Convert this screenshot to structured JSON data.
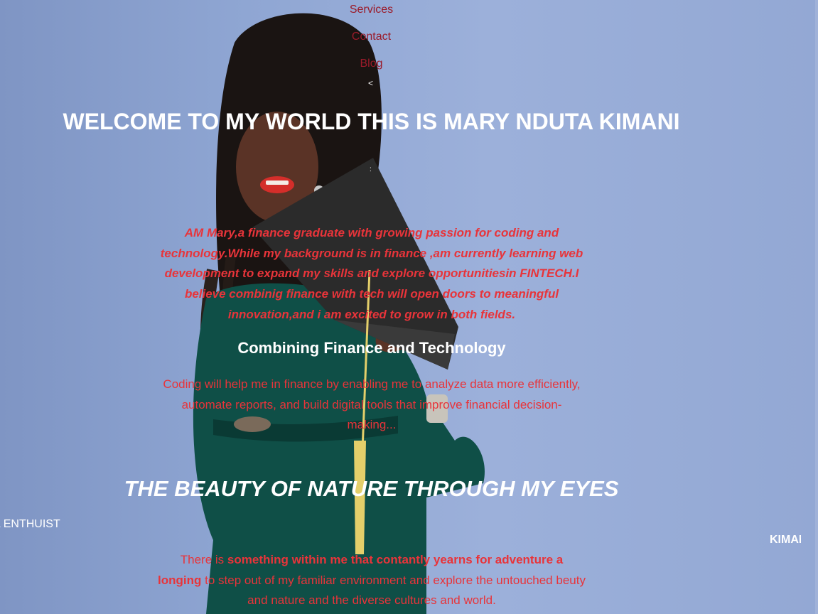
{
  "nav": {
    "items": [
      "Services",
      "Contact",
      "Blog"
    ],
    "arrow": "<"
  },
  "hero": {
    "title": "WELCOME TO MY WORLD THIS IS MARY NDUTA KIMANI",
    "colon": ":"
  },
  "intro": {
    "text": "AM Mary,a finance graduate with growing passion for coding and technology.While my background is in finance ,am currently learning web development to expand my skills and explore opportunitiesin FINTECH.I believe combinig finance with tech will open doors to meaningful innovation,and i am excited to grow in both fields."
  },
  "combining": {
    "title": "Combining Finance and Technology",
    "text": "Coding will help me in finance by enabling me to analyze data more efficiently, automate reports, and build digital tools that improve financial decision-making..."
  },
  "nature": {
    "title": "THE BEAUTY OF NATURE THROUGH MY EYES",
    "marquee_left": "L ENTHUIST",
    "marquee_right": "KIMANI",
    "text_before": "There is ",
    "text_bold": "something within me that contantly yearns for adventure a longing",
    "text_after": " to step out of my familiar environment and explore the untouched beuty and nature and the diverse cultures and world."
  },
  "colors": {
    "background": "#93a8d4",
    "accent_red": "#e8343a",
    "nav_red": "#9b1b2a",
    "dress_green": "#0f4f47"
  }
}
